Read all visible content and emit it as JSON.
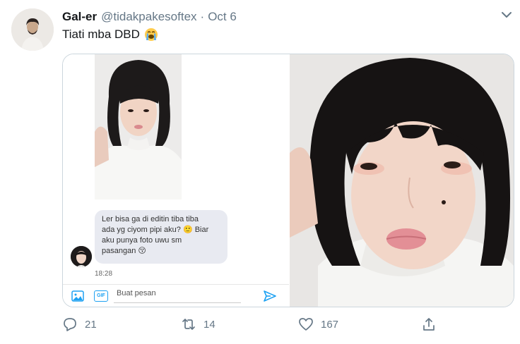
{
  "tweet": {
    "display_name": "Gal-er",
    "handle": "@tidakpakesoftex",
    "separator": "·",
    "date": "Oct 6",
    "text": "Tiati mba DBD",
    "text_emoji": "loudly-crying-face-emoji"
  },
  "media": {
    "chat": {
      "message_lines": [
        "Ler bisa ga di editin tiba tiba",
        "ada yg ciyom pipi aku? 🙂 Biar",
        "aku punya foto uwu sm",
        "pasangan 😚"
      ],
      "time": "18:28",
      "input_placeholder": "Buat pesan",
      "accent": "#1da1f2"
    }
  },
  "actions": {
    "replies": "21",
    "retweets": "14",
    "likes": "167"
  },
  "icons": [
    "avatar",
    "chevron-down-icon",
    "image-icon",
    "gif-icon",
    "send-icon",
    "reply-icon",
    "retweet-icon",
    "like-icon",
    "share-icon"
  ],
  "colors": {
    "muted_text": "#657786",
    "primary_text": "#14171a",
    "border": "#ccd6dd",
    "bubble": "#e8eaf1"
  }
}
